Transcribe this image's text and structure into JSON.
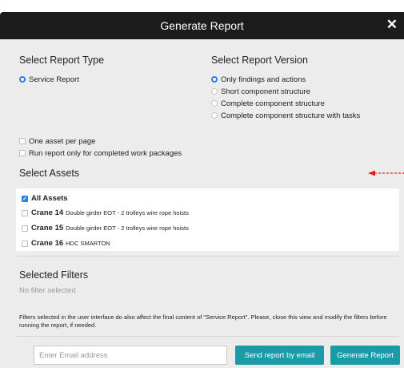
{
  "dialog": {
    "title": "Generate Report",
    "close_icon": "close-icon"
  },
  "report_type": {
    "heading": "Select Report Type",
    "options": [
      {
        "label": "Service Report",
        "selected": true
      }
    ]
  },
  "report_version": {
    "heading": "Select Report Version",
    "options": [
      {
        "label": "Only findings and actions",
        "selected": true
      },
      {
        "label": "Short component structure",
        "selected": false
      },
      {
        "label": "Complete component structure",
        "selected": false
      },
      {
        "label": "Complete component structure with tasks",
        "selected": false
      }
    ]
  },
  "page_options": [
    {
      "label": "One asset per page",
      "checked": false
    },
    {
      "label": "Run report only for completed work packages",
      "checked": false
    }
  ],
  "assets": {
    "heading": "Select Assets",
    "all_label": "All Assets",
    "all_checked": true,
    "items": [
      {
        "name": "Crane 14",
        "description": "Double girder EOT - 2 trolleys wire rope hoists",
        "checked": false
      },
      {
        "name": "Crane 15",
        "description": "Double girder EOT - 2 trolleys wire rope hoists",
        "checked": false
      },
      {
        "name": "Crane 16",
        "description": "HDC SMARTON",
        "checked": false
      }
    ]
  },
  "filters": {
    "heading": "Selected Filters",
    "empty_text": "No filter selected",
    "note": "Filters selected in the user interface do also affect the final content of \"Service Report\". Please, close this view and modify the filters before running the report, if needed."
  },
  "footer": {
    "email_placeholder": "Enter Email address",
    "send_button": "Send report by email",
    "generate_button": "Generate Report"
  },
  "colors": {
    "accent": "#1b9ba8",
    "radio_selected": "#2a7fe0",
    "header_bg": "#1c1c1c",
    "arrow": "#e02020"
  }
}
